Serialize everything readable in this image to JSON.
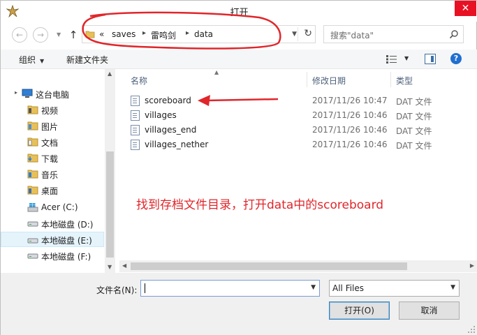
{
  "window": {
    "title": "打开"
  },
  "nav": {
    "back": "←",
    "forward": "→",
    "up": "↑"
  },
  "address": {
    "overflow": "«",
    "crumbs": [
      "saves",
      "雷鸣剑",
      "data"
    ]
  },
  "search": {
    "placeholder": "搜索\"data\""
  },
  "toolbar": {
    "organize": "组织",
    "new_folder": "新建文件夹"
  },
  "sidebar": {
    "items": [
      {
        "label": "这台电脑",
        "icon": "computer-icon"
      },
      {
        "label": "视频",
        "icon": "videos-folder-icon"
      },
      {
        "label": "图片",
        "icon": "pictures-folder-icon"
      },
      {
        "label": "文档",
        "icon": "documents-folder-icon"
      },
      {
        "label": "下载",
        "icon": "downloads-folder-icon"
      },
      {
        "label": "音乐",
        "icon": "music-folder-icon"
      },
      {
        "label": "桌面",
        "icon": "desktop-folder-icon"
      },
      {
        "label": "Acer (C:)",
        "icon": "windows-drive-icon"
      },
      {
        "label": "本地磁盘 (D:)",
        "icon": "drive-icon"
      },
      {
        "label": "本地磁盘 (E:)",
        "icon": "drive-icon"
      },
      {
        "label": "本地磁盘 (F:)",
        "icon": "drive-icon"
      }
    ]
  },
  "columns": {
    "name": "名称",
    "modified": "修改日期",
    "type": "类型"
  },
  "files": [
    {
      "name": "scoreboard",
      "modified": "2017/11/26 10:47",
      "type": "DAT 文件"
    },
    {
      "name": "villages",
      "modified": "2017/11/26 10:46",
      "type": "DAT 文件"
    },
    {
      "name": "villages_end",
      "modified": "2017/11/26 10:46",
      "type": "DAT 文件"
    },
    {
      "name": "villages_nether",
      "modified": "2017/11/26 10:46",
      "type": "DAT 文件"
    }
  ],
  "annotation": {
    "text": "找到存档文件目录，打开data中的scoreboard"
  },
  "footer": {
    "filename_label": "文件名(N):",
    "filename_value": "",
    "filetype": "All Files",
    "open_button": "打开(O)",
    "cancel_button": "取消"
  },
  "colors": {
    "annotation_red": "#e0262b",
    "accent": "#1f6fd0"
  }
}
